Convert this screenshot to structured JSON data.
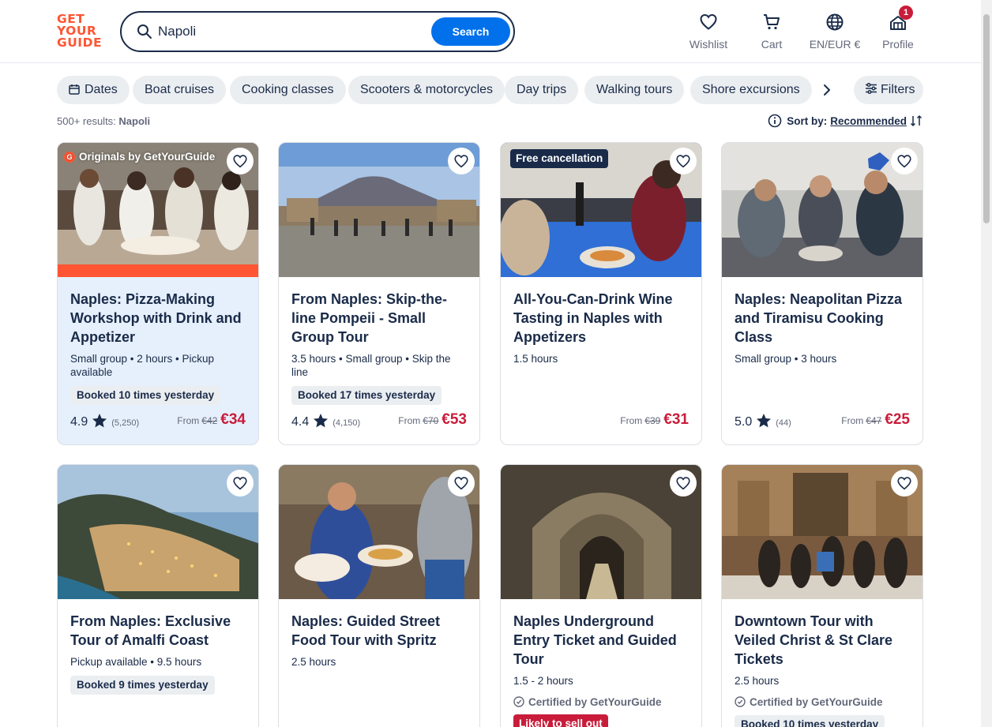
{
  "header": {
    "logo_lines": [
      "GET",
      "YOUR",
      "GUIDE"
    ],
    "search_value": "Napoli",
    "search_button": "Search",
    "nav": [
      {
        "label": "Wishlist",
        "icon": "heart-icon"
      },
      {
        "label": "Cart",
        "icon": "cart-icon"
      },
      {
        "label": "EN/EUR €",
        "icon": "globe-icon"
      },
      {
        "label": "Profile",
        "icon": "profile-icon",
        "badge": "1"
      }
    ]
  },
  "chips": [
    {
      "label": "Dates",
      "icon": "calendar-icon"
    },
    {
      "label": "Boat cruises"
    },
    {
      "label": "Cooking classes"
    },
    {
      "label": "Scooters & motorcycles"
    },
    {
      "label": "Day trips"
    },
    {
      "label": "Walking tours"
    },
    {
      "label": "Shore excursions"
    }
  ],
  "filters_label": "Filters",
  "results": {
    "count": "500+ results:",
    "query": "Napoli"
  },
  "sort": {
    "label": "Sort by:",
    "value": "Recommended"
  },
  "colors": {
    "accent": "#0071eb",
    "brand": "#ff5533",
    "price": "#c91c3a",
    "navy": "#1a2b49"
  },
  "cards": [
    {
      "title": "Naples: Pizza-Making Workshop with Drink and Appetizer",
      "meta": "Small group • 2 hours • Pickup available",
      "booked": "Booked 10 times yesterday",
      "rating": "4.9",
      "reviews": "(5,250)",
      "from": "From",
      "old_price": "€42",
      "price": "€34",
      "overlay": "Originals by GetYourGuide",
      "overlay_badge": "G"
    },
    {
      "title": "From Naples: Skip-the-line Pompeii - Small Group Tour",
      "meta": "3.5 hours • Small group • Skip the line",
      "booked": "Booked 17 times yesterday",
      "rating": "4.4",
      "reviews": "(4,150)",
      "from": "From",
      "old_price": "€70",
      "price": "€53"
    },
    {
      "title": "All-You-Can-Drink Wine Tasting in Naples with Appetizers",
      "meta": "1.5 hours",
      "from": "From",
      "old_price": "€39",
      "price": "€31",
      "tag": "Free cancellation"
    },
    {
      "title": "Naples: Neapolitan Pizza and Tiramisu Cooking Class",
      "meta": "Small group • 3 hours",
      "rating": "5.0",
      "reviews": "(44)",
      "from": "From",
      "old_price": "€47",
      "price": "€25"
    },
    {
      "title": "From Naples: Exclusive Tour of Amalfi Coast",
      "meta": "Pickup available • 9.5 hours",
      "booked": "Booked 9 times yesterday"
    },
    {
      "title": "Naples: Guided Street Food Tour with Spritz",
      "meta": "2.5 hours"
    },
    {
      "title": "Naples Underground Entry Ticket and Guided Tour",
      "meta": "1.5 - 2 hours",
      "certified": "Certified by GetYourGuide",
      "sellout": "Likely to sell out"
    },
    {
      "title": "Downtown Tour with Veiled Christ & St Clare Tickets",
      "meta": "2.5 hours",
      "certified": "Certified by GetYourGuide",
      "booked": "Booked 10 times yesterday"
    }
  ]
}
